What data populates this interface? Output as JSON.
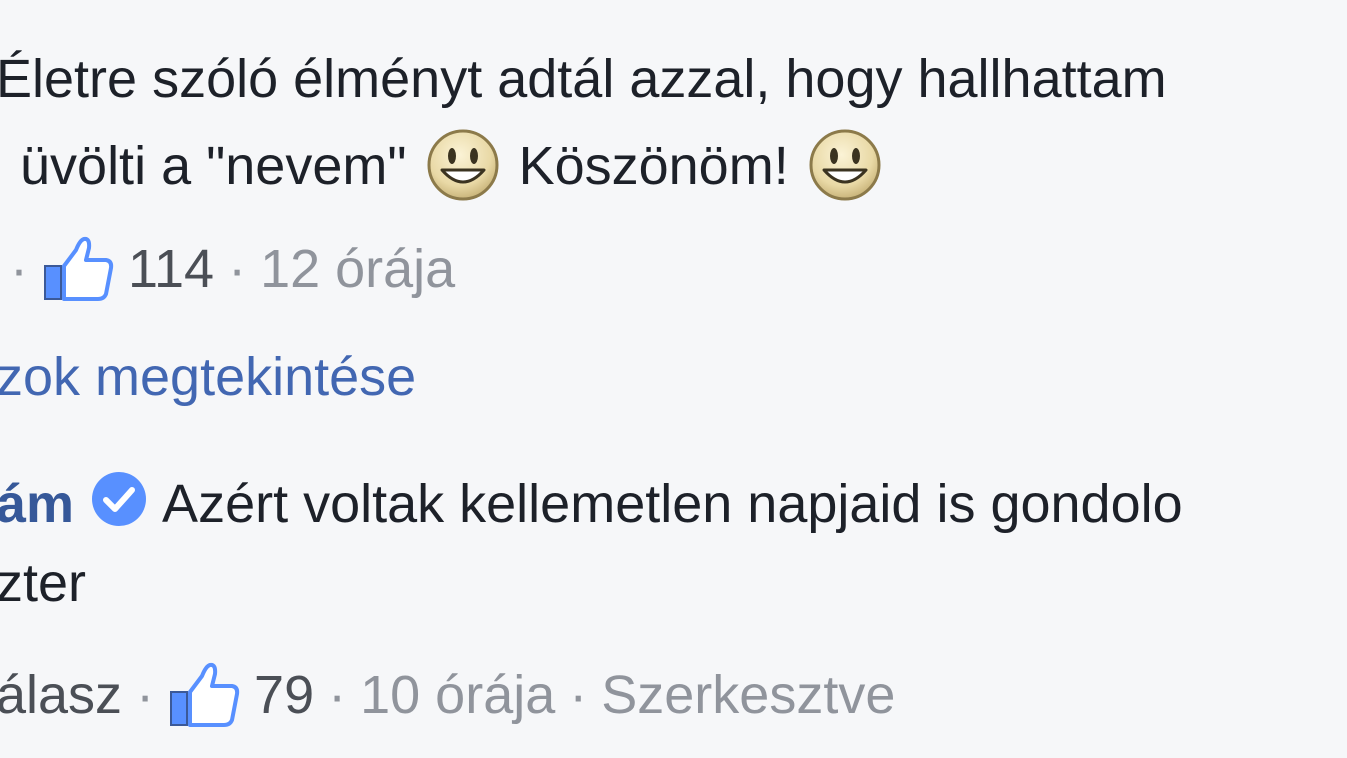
{
  "comment1": {
    "text_line1": "Életre szóló élményt adtál azzal, hogy hallhattam",
    "text_line2_a": "üvölti a \"nevem\"",
    "text_line2_b": "Köszönöm!",
    "emoji": "smiley-emoji-icon",
    "meta": {
      "likes": "114",
      "time": "12 órája",
      "separator": "·"
    }
  },
  "replies_link": "zok megtekintése",
  "comment2": {
    "author": "ám",
    "text_line1": "Azért voltak kellemetlen napjaid is gondolo",
    "text_line2": "zter",
    "meta": {
      "reply_label": "álasz",
      "likes": "79",
      "time": "10 órája",
      "edited": "Szerkesztve",
      "separator": "·"
    }
  },
  "colors": {
    "background": "#f6f7f9",
    "text": "#1d2129",
    "meta": "#90949c",
    "link": "#4267b2",
    "like_icon": "#5890ff",
    "verified": "#5890ff"
  }
}
